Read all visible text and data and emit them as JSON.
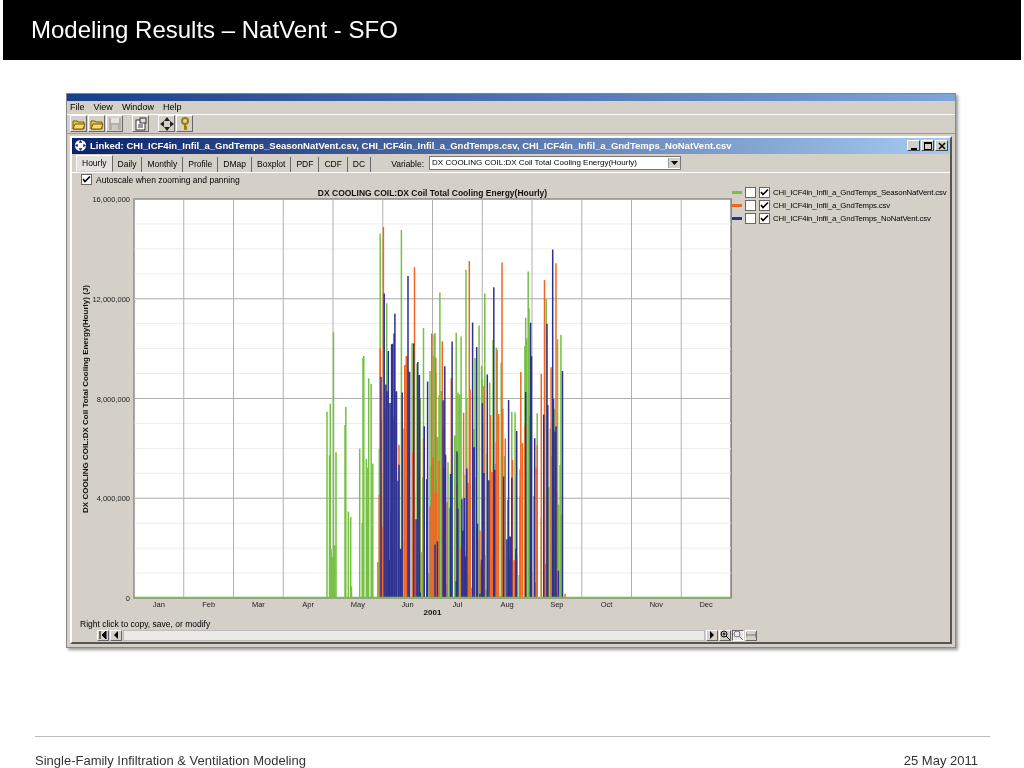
{
  "slide": {
    "title": "Modeling Results – NatVent - SFO",
    "footer_left": "Single-Family Infiltration & Ventilation Modeling",
    "footer_right": "25 May 2011"
  },
  "app": {
    "menu": [
      "File",
      "View",
      "Window",
      "Help"
    ],
    "toolbar": [
      {
        "kind": "open",
        "disabled": false
      },
      {
        "kind": "open",
        "disabled": false
      },
      {
        "kind": "save",
        "disabled": true
      },
      {
        "kind": "properties",
        "disabled": false
      },
      {
        "kind": "pan",
        "disabled": false
      },
      {
        "kind": "help",
        "disabled": false
      }
    ]
  },
  "document": {
    "title": "Linked: CHI_ICF4in_Infil_a_GndTemps_SeasonNatVent.csv, CHI_ICF4in_Infil_a_GndTemps.csv, CHI_ICF4in_Infil_a_GndTemps_NoNatVent.csv",
    "tabs": [
      {
        "label": "Hourly",
        "selected": true
      },
      {
        "label": "Daily",
        "selected": false
      },
      {
        "label": "Monthly",
        "selected": false
      },
      {
        "label": "Profile",
        "selected": false
      },
      {
        "label": "DMap",
        "selected": false
      },
      {
        "label": "Boxplot",
        "selected": false
      },
      {
        "label": "PDF",
        "selected": false
      },
      {
        "label": "CDF",
        "selected": false
      },
      {
        "label": "DC",
        "selected": false
      }
    ],
    "variable_label": "Variable:",
    "variable_value": "DX COOLING COIL:DX Coil Total Cooling Energy(Hourly)",
    "autoscale": {
      "label": "Autoscale when zooming and panning",
      "checked": true
    },
    "chart": {
      "title": "DX COOLING COIL:DX Coil Total Cooling Energy(Hourly)",
      "ylabel": "DX COOLING COIL:DX Coil Total Cooling Energy(Hourly) (J)",
      "yticks": [
        "16,000,000",
        "12,000,000",
        "8,000,000",
        "4,000,000",
        "0"
      ],
      "months": [
        "Jan",
        "Feb",
        "Mar",
        "Apr",
        "May",
        "Jun",
        "Jul",
        "Aug",
        "Sep",
        "Oct",
        "Nov",
        "Dec"
      ],
      "xlabel": "2001"
    },
    "legend": [
      {
        "name": "CHI_ICF4in_Infil_a_GndTemps_SeasonNatVent.csv",
        "color": "#76c043",
        "marker_checked": false,
        "checked": true
      },
      {
        "name": "CHI_ICF4in_Infil_a_GndTemps.csv",
        "color": "#f26522",
        "marker_checked": false,
        "checked": true
      },
      {
        "name": "CHI_ICF4in_Infil_a_GndTemps_NoNatVent.csv",
        "color": "#2e3192",
        "marker_checked": false,
        "checked": true
      }
    ],
    "hint": "Right click to copy, save, or modify"
  }
}
